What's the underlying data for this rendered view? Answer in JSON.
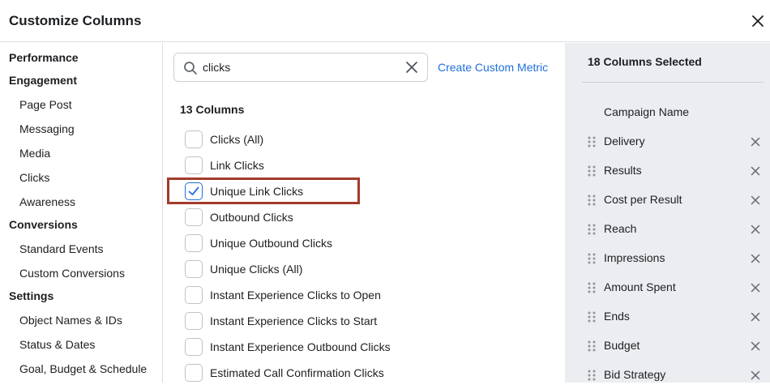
{
  "dialog": {
    "title": "Customize Columns"
  },
  "nav": [
    {
      "label": "Performance",
      "kind": "section"
    },
    {
      "label": "Engagement",
      "kind": "section"
    },
    {
      "label": "Page Post",
      "kind": "sub"
    },
    {
      "label": "Messaging",
      "kind": "sub"
    },
    {
      "label": "Media",
      "kind": "sub"
    },
    {
      "label": "Clicks",
      "kind": "sub"
    },
    {
      "label": "Awareness",
      "kind": "sub"
    },
    {
      "label": "Conversions",
      "kind": "section"
    },
    {
      "label": "Standard Events",
      "kind": "sub"
    },
    {
      "label": "Custom Conversions",
      "kind": "sub"
    },
    {
      "label": "Settings",
      "kind": "section"
    },
    {
      "label": "Object Names & IDs",
      "kind": "sub"
    },
    {
      "label": "Status & Dates",
      "kind": "sub"
    },
    {
      "label": "Goal, Budget & Schedule",
      "kind": "sub"
    }
  ],
  "search": {
    "value": "clicks",
    "icon": "search-icon",
    "clear_icon": "clear-icon"
  },
  "create_metric_link": "Create Custom Metric",
  "column_count": "13 Columns",
  "options": [
    {
      "label": "Clicks (All)",
      "checked": false
    },
    {
      "label": "Link Clicks",
      "checked": false
    },
    {
      "label": "Unique Link Clicks",
      "checked": true
    },
    {
      "label": "Outbound Clicks",
      "checked": false
    },
    {
      "label": "Unique Outbound Clicks",
      "checked": false
    },
    {
      "label": "Unique Clicks (All)",
      "checked": false
    },
    {
      "label": "Instant Experience Clicks to Open",
      "checked": false
    },
    {
      "label": "Instant Experience Clicks to Start",
      "checked": false
    },
    {
      "label": "Instant Experience Outbound Clicks",
      "checked": false
    },
    {
      "label": "Estimated Call Confirmation Clicks",
      "checked": false
    }
  ],
  "selected": {
    "count_label": "18 Columns Selected",
    "fixed": "Campaign Name",
    "items": [
      "Delivery",
      "Results",
      "Cost per Result",
      "Reach",
      "Impressions",
      "Amount Spent",
      "Ends",
      "Budget",
      "Bid Strategy"
    ]
  },
  "colors": {
    "accent": "#216fdb",
    "highlight": "#a33a2a",
    "panel": "#ebedf0"
  }
}
